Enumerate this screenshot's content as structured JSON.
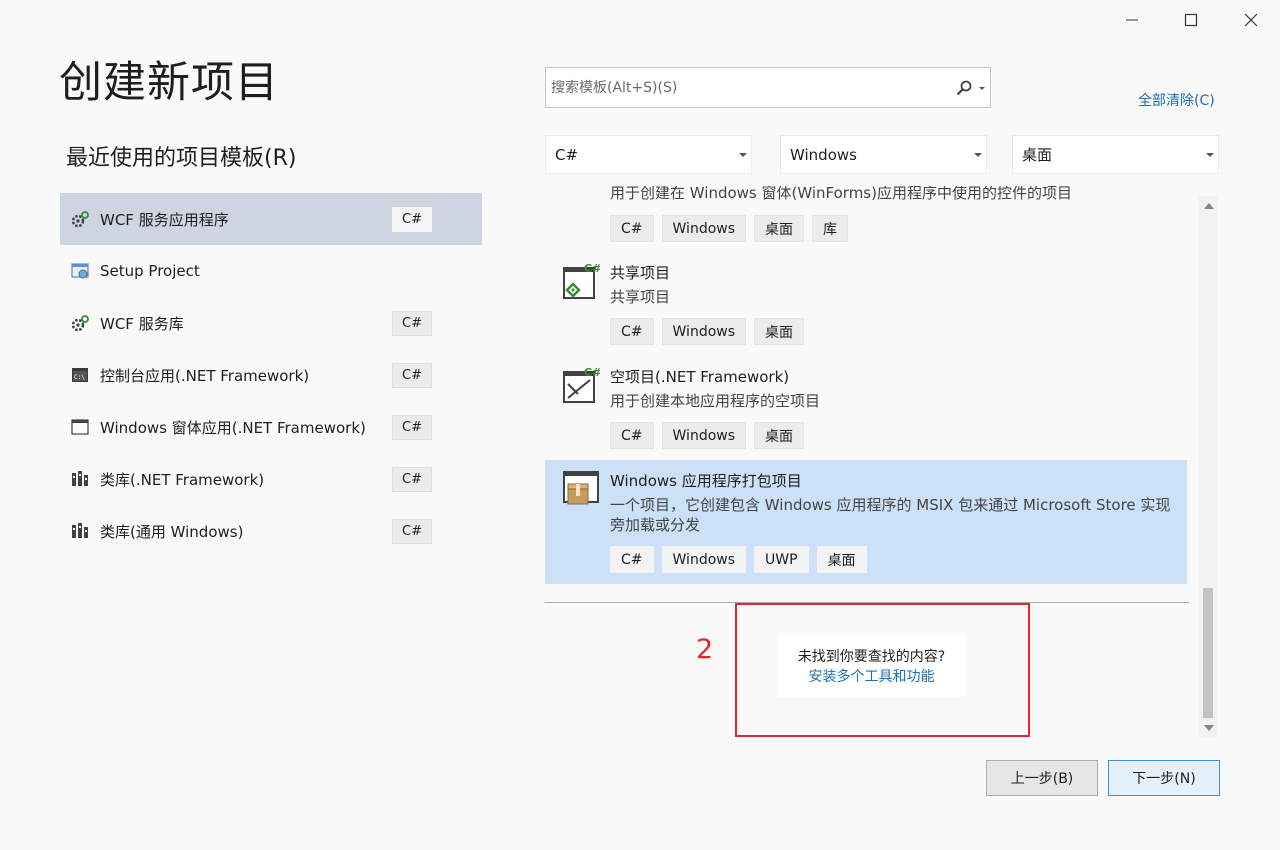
{
  "window": {
    "controls": [
      "minimize-icon",
      "maximize-icon",
      "close-icon"
    ]
  },
  "header": {
    "title": "创建新项目",
    "recent_title": "最近使用的项目模板(R)"
  },
  "search": {
    "placeholder": "搜索模板(Alt+S)(S)",
    "icon": "search-icon",
    "clear_all": "全部清除(C)"
  },
  "filters": [
    {
      "value": "C#"
    },
    {
      "value": "Windows"
    },
    {
      "value": "桌面"
    }
  ],
  "recent": [
    {
      "label": "WCF 服务应用程序",
      "tag": "C#",
      "icon": "wcf-icon",
      "selected": true
    },
    {
      "label": "Setup Project",
      "tag": "",
      "icon": "setup-icon"
    },
    {
      "label": "WCF 服务库",
      "tag": "C#",
      "icon": "wcf-icon"
    },
    {
      "label": "控制台应用(.NET Framework)",
      "tag": "C#",
      "icon": "console-icon"
    },
    {
      "label": "Windows 窗体应用(.NET Framework)",
      "tag": "C#",
      "icon": "window-icon"
    },
    {
      "label": "类库(.NET Framework)",
      "tag": "C#",
      "icon": "class-library-icon"
    },
    {
      "label": "类库(通用 Windows)",
      "tag": "C#",
      "icon": "class-library-icon"
    }
  ],
  "templates": [
    {
      "name": "",
      "desc": "用于创建在 Windows 窗体(WinForms)应用程序中使用的控件的项目",
      "tags": [
        "C#",
        "Windows",
        "桌面",
        "库"
      ],
      "icon": ""
    },
    {
      "name": "共享项目",
      "desc": "共享项目",
      "tags": [
        "C#",
        "Windows",
        "桌面"
      ],
      "icon": "shared-project-icon"
    },
    {
      "name": "空项目(.NET Framework)",
      "desc": "用于创建本地应用程序的空项目",
      "tags": [
        "C#",
        "Windows",
        "桌面"
      ],
      "icon": "empty-project-icon"
    },
    {
      "name": "Windows 应用程序打包项目",
      "desc": "一个项目，它创建包含 Windows 应用程序的 MSIX 包来通过 Microsoft Store 实现旁加载或分发",
      "tags": [
        "C#",
        "Windows",
        "UWP",
        "桌面"
      ],
      "icon": "package-project-icon",
      "selected": true
    }
  ],
  "not_found": {
    "question": "未找到你要查找的内容?",
    "link": "安装多个工具和功能"
  },
  "annotation": {
    "number": "2",
    "color": "#e0282e"
  },
  "buttons": {
    "back": "上一步(B)",
    "next": "下一步(N)"
  },
  "colors": {
    "accent": "#1a6fb5",
    "selected_template_bg": "#cce0f7",
    "selected_recent_bg": "#cfd4e1"
  }
}
